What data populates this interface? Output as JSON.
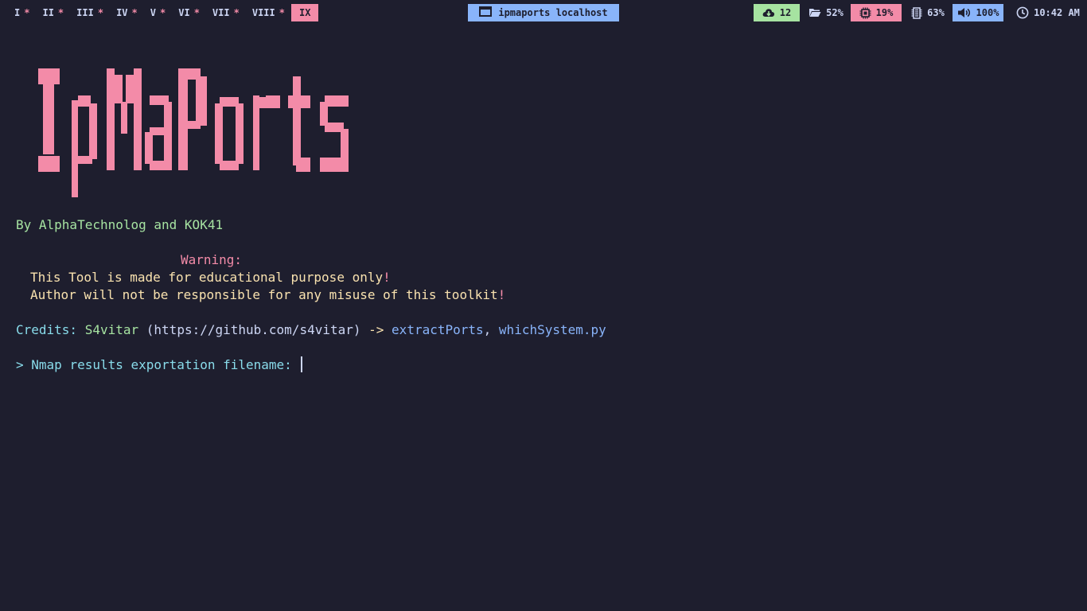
{
  "workspaces": [
    {
      "label": "I",
      "marker": "*"
    },
    {
      "label": "II",
      "marker": "*"
    },
    {
      "label": "III",
      "marker": "*"
    },
    {
      "label": "IV",
      "marker": "*"
    },
    {
      "label": "V",
      "marker": "*"
    },
    {
      "label": "VI",
      "marker": "*"
    },
    {
      "label": "VII",
      "marker": "*"
    },
    {
      "label": "VIII",
      "marker": "*"
    },
    {
      "label": "IX",
      "marker": ""
    }
  ],
  "window_title": "ipmaports localhost",
  "status": {
    "updates": "12",
    "disk": "52%",
    "cpu": "19%",
    "memory": "63%",
    "volume": "100%",
    "clock": "10:42 AM"
  },
  "colors": {
    "background": "#1e1e2e",
    "accent_pink": "#f38ba8",
    "accent_green": "#a6e3a1",
    "accent_blue": "#89b4fa",
    "accent_yellow": "#f9e2af"
  },
  "icons": [
    "window-icon",
    "cloud-download-icon",
    "folder-icon",
    "cpu-icon",
    "memory-icon",
    "volume-icon",
    "clock-icon"
  ],
  "terminal": {
    "banner": "IpMaPorts",
    "byline": "By AlphaTechnolog and KOK41",
    "warning_label": "Warning:",
    "warning_line1": "This Tool is made for educational purpose only",
    "warning_line2": "Author will not be responsible for any misuse of this toolkit",
    "exclaim": "!",
    "credits_label": "Credits:",
    "credits_author": "S4vitar",
    "credits_url": "(https://github.com/s4vitar)",
    "credits_arrow": "->",
    "credits_tool1": "extractPorts",
    "credits_sep": ",",
    "credits_tool2": "whichSystem.py",
    "prompt_symbol": ">",
    "prompt_text": "Nmap results exportation filename:",
    "input_value": ""
  }
}
